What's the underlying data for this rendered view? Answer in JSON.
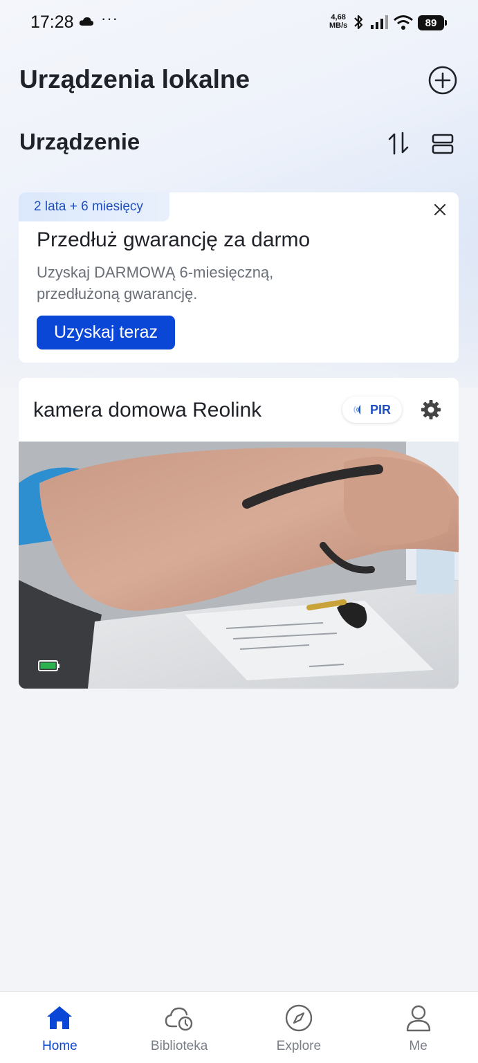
{
  "status_bar": {
    "time": "17:28",
    "speed_value": "4,68",
    "speed_unit": "MB/s",
    "battery": "89"
  },
  "header": {
    "title": "Urządzenia lokalne",
    "section_title": "Urządzenie"
  },
  "promo": {
    "tag": "2 lata + 6 miesięcy",
    "title": "Przedłuż gwarancję za darmo",
    "description": "Uzyskaj DARMOWĄ 6-miesięczną, przedłużoną gwarancję.",
    "button_label": "Uzyskaj teraz"
  },
  "camera": {
    "name": "kamera domowa Reolink",
    "badge": "PIR",
    "battery_level": 1.0
  },
  "bottom_nav": {
    "items": [
      {
        "label": "Home",
        "icon": "home-icon",
        "active": true
      },
      {
        "label": "Biblioteka",
        "icon": "cloud-clock-icon",
        "active": false
      },
      {
        "label": "Explore",
        "icon": "compass-icon",
        "active": false
      },
      {
        "label": "Me",
        "icon": "person-icon",
        "active": false
      }
    ]
  },
  "colors": {
    "accent": "#0b47d6",
    "tag_text": "#1f4fbf",
    "battery_green": "#2bb24c"
  }
}
